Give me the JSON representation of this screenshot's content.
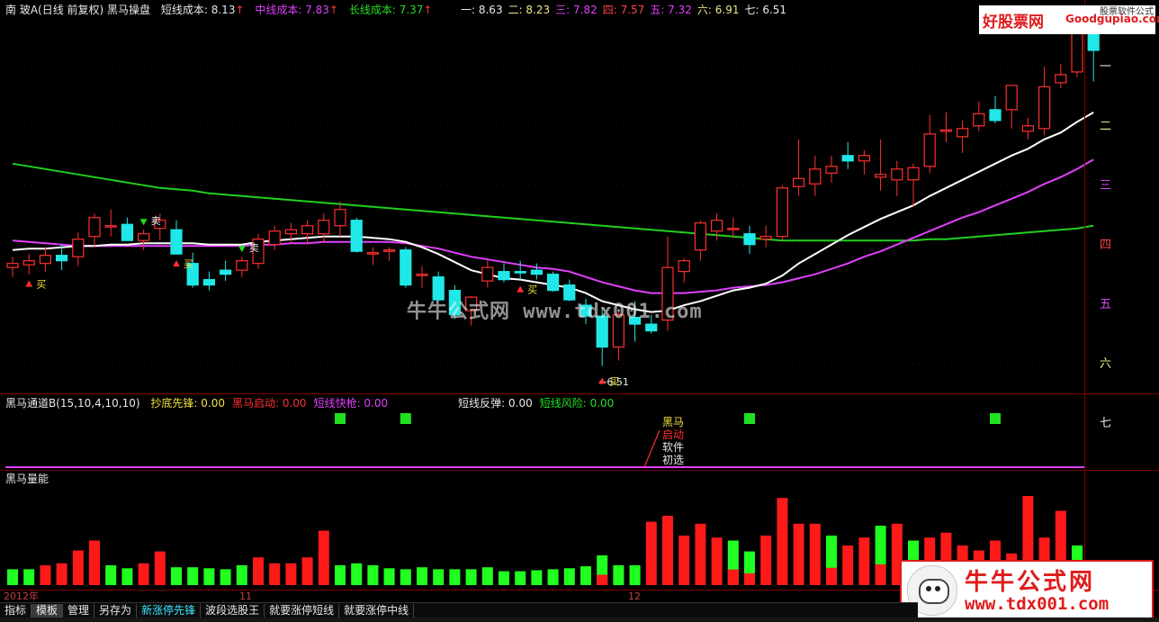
{
  "header": {
    "title": "南  玻A(日线 前复权) 黑马操盘",
    "short_cost_label": "短线成本:",
    "short_cost": "8.13",
    "mid_cost_label": "中线成本:",
    "mid_cost": "7.83",
    "long_cost_label": "长线成本:",
    "long_cost": "7.37",
    "levels": [
      {
        "name": "一:",
        "value": "8.63",
        "color": "#e8e8e8"
      },
      {
        "name": "二:",
        "value": "8.23",
        "color": "#f0e68c"
      },
      {
        "name": "三:",
        "value": "7.82",
        "color": "#e040fb"
      },
      {
        "name": "四:",
        "value": "7.57",
        "color": "#ff4444"
      },
      {
        "name": "五:",
        "value": "7.32",
        "color": "#e040fb"
      },
      {
        "name": "六:",
        "value": "6.91",
        "color": "#f0e68c"
      },
      {
        "name": "七:",
        "value": "6.51",
        "color": "#e8e8e8"
      }
    ]
  },
  "right_levels": [
    {
      "label": "一",
      "color": "#e8e8e8"
    },
    {
      "label": "二",
      "color": "#f0e68c"
    },
    {
      "label": "三",
      "color": "#e040fb"
    },
    {
      "label": "四",
      "color": "#ff4444"
    },
    {
      "label": "五",
      "color": "#e040fb"
    },
    {
      "label": "六",
      "color": "#f0e68c"
    },
    {
      "label": "七",
      "color": "#e8e8e8"
    }
  ],
  "indicator2": {
    "name": "黑马通道B(15,10,4,10,10)",
    "items": [
      {
        "label": "抄底先锋:",
        "value": "0.00",
        "color": "#f0e040"
      },
      {
        "label": "黑马启动:",
        "value": "0.00",
        "color": "#ff3030"
      },
      {
        "label": "短线快枪:",
        "value": "0.00",
        "color": "#e040fb"
      },
      {
        "label": "短线反弹:",
        "value": "0.00",
        "color": "#e8e8e8"
      },
      {
        "label": "短线风险:",
        "value": "0.00",
        "color": "#20e020"
      }
    ],
    "annotation": [
      "黑马",
      "启动",
      "软件",
      "初选"
    ]
  },
  "indicator3": {
    "name": "黑马量能"
  },
  "axis_dates": [
    "2012年",
    "11",
    "12"
  ],
  "low_label": "←6.51",
  "signal_buy": "买",
  "signal_sell": "卖",
  "tabs": [
    {
      "label": "指标",
      "selected": false,
      "cyan": false
    },
    {
      "label": "模板",
      "selected": true,
      "cyan": false
    },
    {
      "label": "管理",
      "selected": false,
      "cyan": false
    },
    {
      "label": "另存为",
      "selected": false,
      "cyan": false
    },
    {
      "label": "新涨停先锋",
      "selected": false,
      "cyan": true
    },
    {
      "label": "波段选股王",
      "selected": false,
      "cyan": false
    },
    {
      "label": "就要涨停短线",
      "selected": false,
      "cyan": false
    },
    {
      "label": "就要涨停中线",
      "selected": false,
      "cyan": false
    }
  ],
  "watermark": {
    "top_a": "好股票网",
    "top_b": "Goodgupiao.com",
    "top_c": "股票软件公式",
    "center": "牛牛公式网 www.tdx001.com",
    "bottom_t1": "牛牛公式网",
    "bottom_t2": "www.tdx001.com"
  },
  "colors": {
    "up": "#ff3030",
    "down": "#20e8e8",
    "vol_up": "#ff1a1a",
    "vol_down": "#20ff20",
    "ma_short": "#ffffff",
    "ma_mid": "#e040fb",
    "ma_long": "#20d020"
  },
  "chart_data": {
    "type": "candlestick",
    "y_range": [
      6.45,
      9.2
    ],
    "candles": [
      {
        "o": 7.35,
        "h": 7.43,
        "l": 7.28,
        "c": 7.38
      },
      {
        "o": 7.37,
        "h": 7.45,
        "l": 7.3,
        "c": 7.4
      },
      {
        "o": 7.38,
        "h": 7.5,
        "l": 7.32,
        "c": 7.44
      },
      {
        "o": 7.44,
        "h": 7.52,
        "l": 7.33,
        "c": 7.4
      },
      {
        "o": 7.43,
        "h": 7.61,
        "l": 7.36,
        "c": 7.56
      },
      {
        "o": 7.58,
        "h": 7.75,
        "l": 7.5,
        "c": 7.72
      },
      {
        "o": 7.65,
        "h": 7.78,
        "l": 7.58,
        "c": 7.66
      },
      {
        "o": 7.67,
        "h": 7.72,
        "l": 7.55,
        "c": 7.55
      },
      {
        "o": 7.55,
        "h": 7.63,
        "l": 7.48,
        "c": 7.6
      },
      {
        "o": 7.64,
        "h": 7.75,
        "l": 7.55,
        "c": 7.7
      },
      {
        "o": 7.63,
        "h": 7.7,
        "l": 7.45,
        "c": 7.45
      },
      {
        "o": 7.38,
        "h": 7.46,
        "l": 7.2,
        "c": 7.22
      },
      {
        "o": 7.26,
        "h": 7.32,
        "l": 7.18,
        "c": 7.22
      },
      {
        "o": 7.33,
        "h": 7.4,
        "l": 7.25,
        "c": 7.3
      },
      {
        "o": 7.33,
        "h": 7.43,
        "l": 7.28,
        "c": 7.4
      },
      {
        "o": 7.38,
        "h": 7.6,
        "l": 7.34,
        "c": 7.56
      },
      {
        "o": 7.52,
        "h": 7.66,
        "l": 7.48,
        "c": 7.62
      },
      {
        "o": 7.6,
        "h": 7.68,
        "l": 7.53,
        "c": 7.63
      },
      {
        "o": 7.6,
        "h": 7.7,
        "l": 7.52,
        "c": 7.66
      },
      {
        "o": 7.6,
        "h": 7.75,
        "l": 7.53,
        "c": 7.7
      },
      {
        "o": 7.66,
        "h": 7.84,
        "l": 7.58,
        "c": 7.78
      },
      {
        "o": 7.7,
        "h": 7.72,
        "l": 7.46,
        "c": 7.47
      },
      {
        "o": 7.46,
        "h": 7.5,
        "l": 7.37,
        "c": 7.46
      },
      {
        "o": 7.47,
        "h": 7.5,
        "l": 7.4,
        "c": 7.48
      },
      {
        "o": 7.48,
        "h": 7.5,
        "l": 7.2,
        "c": 7.22
      },
      {
        "o": 7.29,
        "h": 7.36,
        "l": 7.2,
        "c": 7.3
      },
      {
        "o": 7.28,
        "h": 7.32,
        "l": 7.1,
        "c": 7.11
      },
      {
        "o": 7.18,
        "h": 7.22,
        "l": 6.97,
        "c": 7.0
      },
      {
        "o": 7.03,
        "h": 7.14,
        "l": 6.92,
        "c": 7.13
      },
      {
        "o": 7.25,
        "h": 7.4,
        "l": 7.2,
        "c": 7.35
      },
      {
        "o": 7.32,
        "h": 7.38,
        "l": 7.24,
        "c": 7.26
      },
      {
        "o": 7.32,
        "h": 7.4,
        "l": 7.26,
        "c": 7.31
      },
      {
        "o": 7.33,
        "h": 7.38,
        "l": 7.26,
        "c": 7.3
      },
      {
        "o": 7.3,
        "h": 7.32,
        "l": 7.17,
        "c": 7.18
      },
      {
        "o": 7.22,
        "h": 7.26,
        "l": 7.1,
        "c": 7.11
      },
      {
        "o": 7.07,
        "h": 7.12,
        "l": 6.93,
        "c": 6.99
      },
      {
        "o": 6.99,
        "h": 7.05,
        "l": 6.62,
        "c": 6.76
      },
      {
        "o": 6.76,
        "h": 7.04,
        "l": 6.66,
        "c": 7.0
      },
      {
        "o": 6.98,
        "h": 7.1,
        "l": 6.8,
        "c": 6.93
      },
      {
        "o": 6.93,
        "h": 7.0,
        "l": 6.86,
        "c": 6.88
      },
      {
        "o": 6.96,
        "h": 7.58,
        "l": 6.88,
        "c": 7.35
      },
      {
        "o": 7.32,
        "h": 7.42,
        "l": 7.24,
        "c": 7.4
      },
      {
        "o": 7.48,
        "h": 7.7,
        "l": 7.4,
        "c": 7.68
      },
      {
        "o": 7.62,
        "h": 7.75,
        "l": 7.55,
        "c": 7.7
      },
      {
        "o": 7.64,
        "h": 7.72,
        "l": 7.57,
        "c": 7.64
      },
      {
        "o": 7.6,
        "h": 7.66,
        "l": 7.45,
        "c": 7.52
      },
      {
        "o": 7.56,
        "h": 7.66,
        "l": 7.5,
        "c": 7.58
      },
      {
        "o": 7.58,
        "h": 7.96,
        "l": 7.55,
        "c": 7.94
      },
      {
        "o": 7.95,
        "h": 8.3,
        "l": 7.88,
        "c": 8.01
      },
      {
        "o": 7.97,
        "h": 8.18,
        "l": 7.88,
        "c": 8.08
      },
      {
        "o": 8.05,
        "h": 8.18,
        "l": 7.98,
        "c": 8.1
      },
      {
        "o": 8.18,
        "h": 8.28,
        "l": 8.08,
        "c": 8.14
      },
      {
        "o": 8.14,
        "h": 8.22,
        "l": 8.04,
        "c": 8.18
      },
      {
        "o": 8.02,
        "h": 8.3,
        "l": 7.92,
        "c": 8.04
      },
      {
        "o": 8.0,
        "h": 8.14,
        "l": 7.88,
        "c": 8.08
      },
      {
        "o": 8.0,
        "h": 8.12,
        "l": 7.8,
        "c": 8.09
      },
      {
        "o": 8.1,
        "h": 8.48,
        "l": 8.05,
        "c": 8.34
      },
      {
        "o": 8.36,
        "h": 8.5,
        "l": 8.28,
        "c": 8.37
      },
      {
        "o": 8.32,
        "h": 8.44,
        "l": 8.2,
        "c": 8.38
      },
      {
        "o": 8.4,
        "h": 8.58,
        "l": 8.36,
        "c": 8.49
      },
      {
        "o": 8.52,
        "h": 8.62,
        "l": 8.42,
        "c": 8.44
      },
      {
        "o": 8.52,
        "h": 8.62,
        "l": 8.38,
        "c": 8.7
      },
      {
        "o": 8.36,
        "h": 8.46,
        "l": 8.3,
        "c": 8.4
      },
      {
        "o": 8.38,
        "h": 8.84,
        "l": 8.33,
        "c": 8.69
      },
      {
        "o": 8.72,
        "h": 8.86,
        "l": 8.68,
        "c": 8.78
      },
      {
        "o": 8.8,
        "h": 9.1,
        "l": 8.76,
        "c": 9.1
      },
      {
        "o": 9.18,
        "h": 9.28,
        "l": 8.73,
        "c": 8.96
      }
    ],
    "ma_short": [
      7.48,
      7.49,
      7.49,
      7.5,
      7.51,
      7.51,
      7.52,
      7.52,
      7.53,
      7.53,
      7.53,
      7.53,
      7.52,
      7.52,
      7.52,
      7.54,
      7.55,
      7.56,
      7.57,
      7.58,
      7.58,
      7.58,
      7.57,
      7.56,
      7.54,
      7.5,
      7.45,
      7.39,
      7.33,
      7.3,
      7.27,
      7.26,
      7.24,
      7.22,
      7.2,
      7.16,
      7.1,
      7.07,
      7.04,
      7.02,
      7.03,
      7.07,
      7.1,
      7.14,
      7.18,
      7.2,
      7.23,
      7.29,
      7.38,
      7.45,
      7.52,
      7.59,
      7.65,
      7.71,
      7.76,
      7.81,
      7.88,
      7.94,
      8.0,
      8.06,
      8.12,
      8.18,
      8.23,
      8.3,
      8.35,
      8.43,
      8.5
    ],
    "ma_mid": [
      7.55,
      7.54,
      7.53,
      7.52,
      7.51,
      7.51,
      7.51,
      7.51,
      7.51,
      7.51,
      7.51,
      7.51,
      7.51,
      7.51,
      7.51,
      7.52,
      7.52,
      7.53,
      7.53,
      7.54,
      7.54,
      7.54,
      7.54,
      7.54,
      7.53,
      7.51,
      7.49,
      7.46,
      7.43,
      7.41,
      7.39,
      7.37,
      7.35,
      7.34,
      7.32,
      7.28,
      7.24,
      7.21,
      7.18,
      7.16,
      7.16,
      7.16,
      7.17,
      7.18,
      7.2,
      7.21,
      7.22,
      7.24,
      7.27,
      7.3,
      7.34,
      7.38,
      7.43,
      7.47,
      7.52,
      7.57,
      7.62,
      7.67,
      7.72,
      7.76,
      7.81,
      7.86,
      7.91,
      7.97,
      8.02,
      8.08,
      8.15
    ],
    "ma_long": [
      8.12,
      8.1,
      8.08,
      8.06,
      8.04,
      8.02,
      8.0,
      7.98,
      7.96,
      7.94,
      7.93,
      7.92,
      7.9,
      7.89,
      7.88,
      7.87,
      7.86,
      7.85,
      7.84,
      7.83,
      7.82,
      7.81,
      7.8,
      7.79,
      7.78,
      7.77,
      7.76,
      7.75,
      7.74,
      7.73,
      7.72,
      7.71,
      7.7,
      7.69,
      7.68,
      7.67,
      7.66,
      7.65,
      7.64,
      7.63,
      7.62,
      7.61,
      7.6,
      7.59,
      7.58,
      7.57,
      7.56,
      7.55,
      7.55,
      7.55,
      7.55,
      7.55,
      7.55,
      7.55,
      7.55,
      7.55,
      7.56,
      7.56,
      7.57,
      7.58,
      7.59,
      7.6,
      7.61,
      7.62,
      7.63,
      7.64,
      7.66
    ],
    "volume": [
      0.16,
      0.16,
      0.2,
      0.22,
      0.35,
      0.45,
      0.2,
      0.17,
      0.22,
      0.34,
      0.18,
      0.18,
      0.17,
      0.16,
      0.2,
      0.28,
      0.22,
      0.22,
      0.28,
      0.55,
      0.2,
      0.22,
      0.2,
      0.17,
      0.16,
      0.18,
      0.16,
      0.16,
      0.16,
      0.18,
      0.14,
      0.14,
      0.15,
      0.16,
      0.17,
      0.19,
      0.3,
      0.2,
      0.2,
      0.64,
      0.7,
      0.5,
      0.62,
      0.48,
      0.45,
      0.34,
      0.5,
      0.88,
      0.62,
      0.62,
      0.5,
      0.4,
      0.48,
      0.6,
      0.62,
      0.45,
      0.48,
      0.53,
      0.4,
      0.35,
      0.45,
      0.32,
      0.9,
      0.48,
      0.75,
      0.4
    ],
    "vol_up": [
      false,
      false,
      true,
      true,
      true,
      true,
      false,
      false,
      true,
      true,
      false,
      false,
      false,
      false,
      false,
      true,
      true,
      true,
      true,
      true,
      false,
      false,
      false,
      false,
      false,
      false,
      false,
      false,
      false,
      false,
      false,
      false,
      false,
      false,
      false,
      false,
      false,
      false,
      false,
      true,
      true,
      true,
      true,
      true,
      false,
      false,
      true,
      true,
      true,
      true,
      false,
      true,
      true,
      false,
      true,
      false,
      true,
      true,
      true,
      true,
      true,
      true,
      true,
      true,
      true,
      false
    ],
    "signals_green": [
      20,
      24,
      45,
      60
    ],
    "buy_markers": [
      1,
      10,
      36,
      31
    ],
    "sell_markers": [
      8,
      14
    ]
  }
}
